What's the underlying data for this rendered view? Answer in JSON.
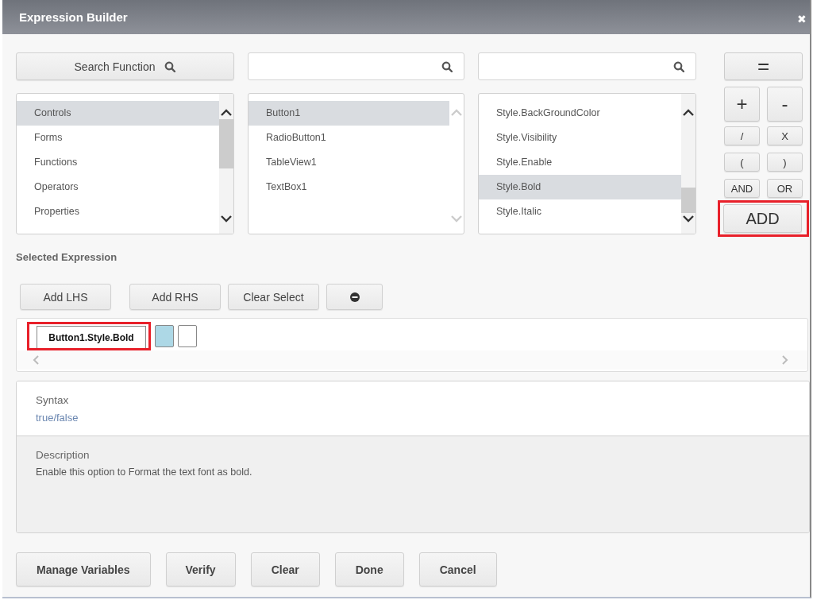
{
  "window": {
    "title": "Expression Builder",
    "close": "✖"
  },
  "search_row": [
    {
      "kind": "button",
      "label": "Search Function"
    },
    {
      "kind": "field"
    },
    {
      "kind": "field"
    }
  ],
  "lists": [
    {
      "scrollable": true,
      "items": [
        {
          "label": "Controls",
          "selected": true
        },
        {
          "label": "Forms",
          "selected": false
        },
        {
          "label": "Functions",
          "selected": false
        },
        {
          "label": "Operators",
          "selected": false
        },
        {
          "label": "Properties",
          "selected": false
        }
      ]
    },
    {
      "scrollable": false,
      "items": [
        {
          "label": "Button1",
          "selected": true
        },
        {
          "label": "RadioButton1",
          "selected": false
        },
        {
          "label": "TableView1",
          "selected": false
        },
        {
          "label": "TextBox1",
          "selected": false
        }
      ]
    },
    {
      "scrollable": true,
      "items": [
        {
          "label": "Style.BackGroundColor",
          "selected": false
        },
        {
          "label": "Style.Visibility",
          "selected": false
        },
        {
          "label": "Style.Enable",
          "selected": false
        },
        {
          "label": "Style.Bold",
          "selected": true
        },
        {
          "label": "Style.Italic",
          "selected": false
        }
      ]
    }
  ],
  "operators": [
    {
      "label": "=",
      "kind": "wide",
      "highlighted": false
    },
    {
      "label": "+",
      "kind": "large",
      "highlighted": false
    },
    {
      "label": "-",
      "kind": "large",
      "highlighted": false
    },
    {
      "label": "/",
      "kind": "small",
      "highlighted": false
    },
    {
      "label": "X",
      "kind": "small",
      "highlighted": false
    },
    {
      "label": "(",
      "kind": "small",
      "highlighted": false
    },
    {
      "label": ")",
      "kind": "small",
      "highlighted": false
    },
    {
      "label": "AND",
      "kind": "small",
      "highlighted": false
    },
    {
      "label": "OR",
      "kind": "small",
      "highlighted": false
    },
    {
      "label": "ADD",
      "kind": "add",
      "highlighted": true
    }
  ],
  "selected_expression": {
    "heading": "Selected Expression",
    "buttons": [
      {
        "kind": "text",
        "label": "Add LHS"
      },
      {
        "kind": "text",
        "label": "Add RHS"
      },
      {
        "kind": "text",
        "label": "Clear Select"
      },
      {
        "kind": "remove"
      }
    ],
    "tokens": [
      {
        "kind": "text",
        "label": "Button1.Style.Bold",
        "highlighted": true
      },
      {
        "kind": "slot",
        "color": "#add8e6"
      },
      {
        "kind": "slot",
        "color": "#ffffff"
      }
    ]
  },
  "syntax": {
    "heading": "Syntax",
    "value": "true/false"
  },
  "description": {
    "heading": "Description",
    "text": "Enable this option to Format the text font as bold."
  },
  "footer_buttons": [
    "Manage Variables",
    "Verify",
    "Clear",
    "Done",
    "Cancel"
  ]
}
